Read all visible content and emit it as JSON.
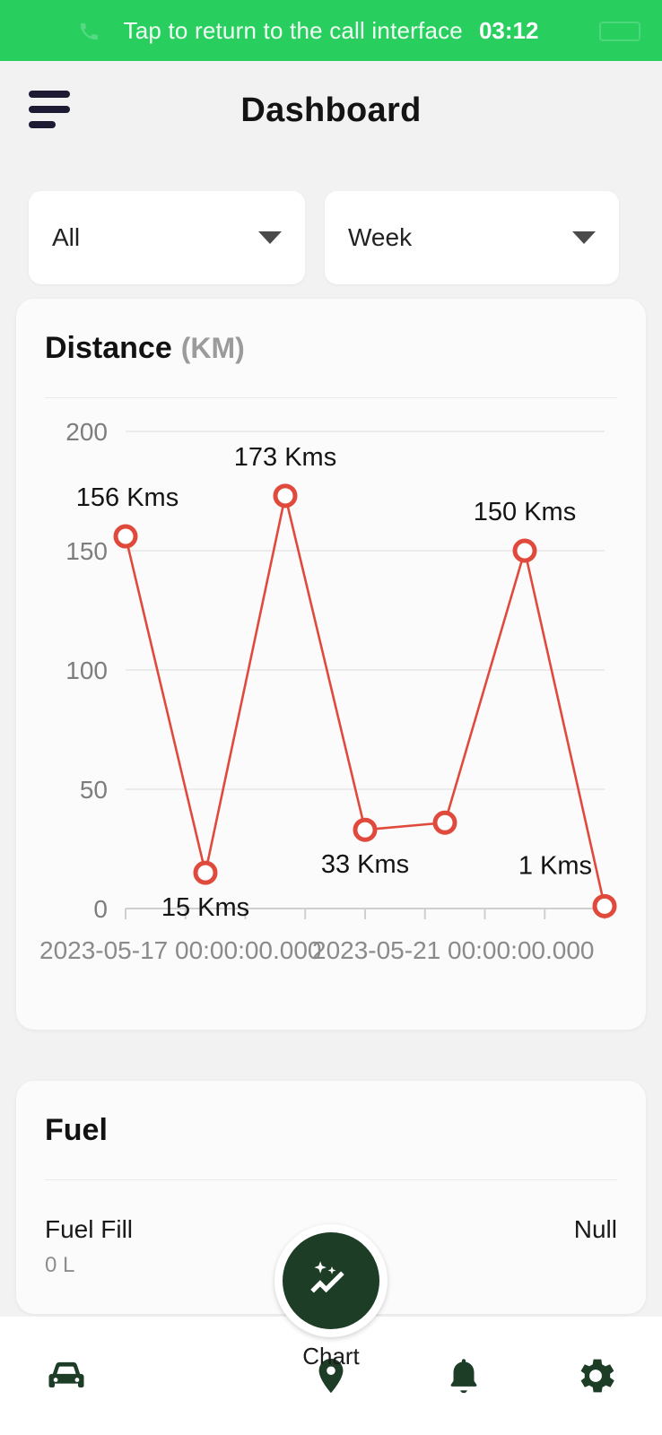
{
  "call_banner": {
    "text": "Tap to return to the call interface",
    "time": "03:12",
    "background": "#28cf5f",
    "icon": "phone-call-icon"
  },
  "appbar": {
    "title": "Dashboard",
    "menu_icon": "hamburger-menu-icon"
  },
  "filters": {
    "vehicle": {
      "value": "All",
      "caret_icon": "chevron-down-icon"
    },
    "period": {
      "value": "Week",
      "caret_icon": "chevron-down-icon"
    }
  },
  "distance_card": {
    "title": "Distance",
    "unit": "(KM)"
  },
  "fuel_card": {
    "title": "Fuel",
    "rows": [
      {
        "label": "Fuel Fill",
        "sub": "0 L",
        "value": "Null"
      }
    ]
  },
  "bottom_nav": {
    "items": [
      {
        "name": "vehicle",
        "icon": "car-icon",
        "label": ""
      },
      {
        "name": "location",
        "icon": "location-pin-icon",
        "label": ""
      },
      {
        "name": "alerts",
        "icon": "bell-icon",
        "label": ""
      },
      {
        "name": "settings",
        "icon": "gear-icon",
        "label": ""
      }
    ],
    "fab": {
      "label": "Chart",
      "icon": "chart-sparkle-icon",
      "color": "#1d3d27"
    }
  },
  "chart_data": {
    "type": "line",
    "title": "Distance (KM)",
    "xlabel": "",
    "ylabel": "",
    "ylim": [
      0,
      200
    ],
    "yticks": [
      0,
      50,
      100,
      150,
      200
    ],
    "grid": true,
    "legend": false,
    "line_color": "#e04a3c",
    "marker": "open-circle",
    "x_axis_labels": [
      "2023-05-17 00:00:00.000",
      "2023-05-21 00:00:00.000"
    ],
    "x_tick_count": 9,
    "point_label_suffix": "Kms",
    "points": [
      {
        "x": 0,
        "y": 156,
        "label": "156 Kms",
        "label_pos": "above-left"
      },
      {
        "x": 1,
        "y": 15,
        "label": "15 Kms",
        "label_pos": "below"
      },
      {
        "x": 2,
        "y": 173,
        "label": "173 Kms",
        "label_pos": "above"
      },
      {
        "x": 3,
        "y": 33,
        "label": "33 Kms",
        "label_pos": "below"
      },
      {
        "x": 4,
        "y": 36,
        "label": "",
        "label_pos": "none"
      },
      {
        "x": 5,
        "y": 150,
        "label": "150 Kms",
        "label_pos": "above"
      },
      {
        "x": 6,
        "y": 1,
        "label": "1 Kms",
        "label_pos": "above-left"
      }
    ],
    "categories": [
      "0",
      "1",
      "2",
      "3",
      "4",
      "5",
      "6"
    ],
    "values": [
      156,
      15,
      173,
      33,
      36,
      150,
      1
    ]
  }
}
